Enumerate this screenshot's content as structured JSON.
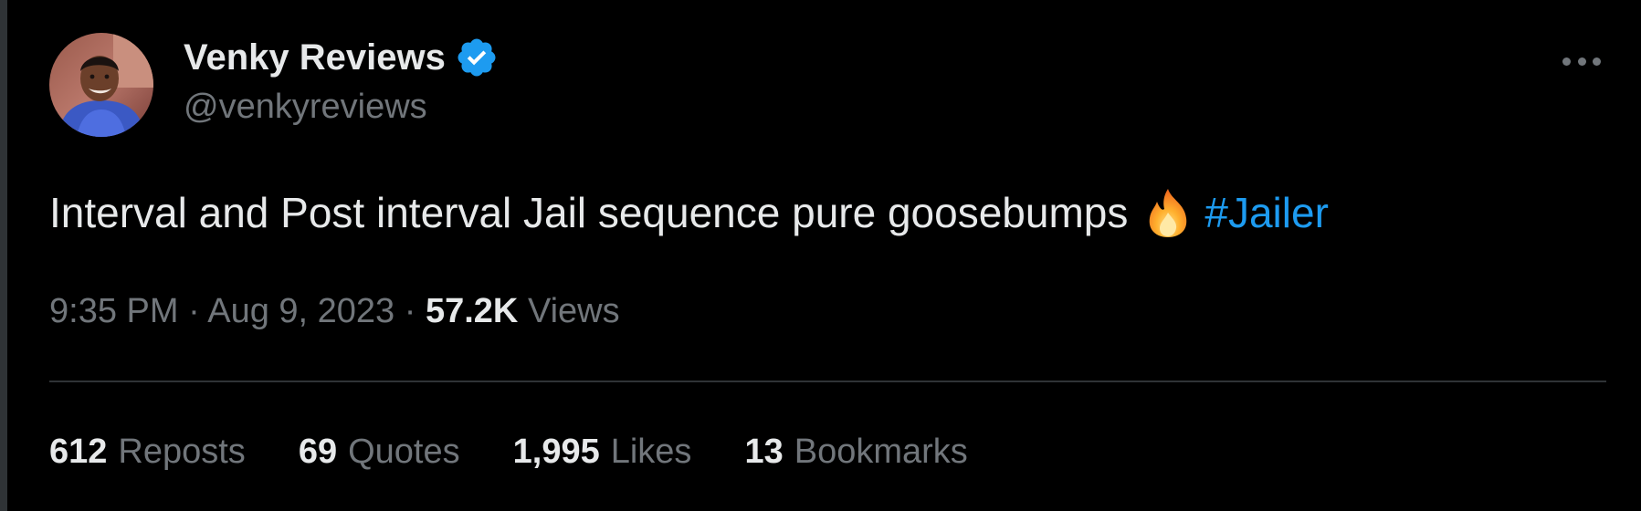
{
  "tweet": {
    "author": {
      "display_name": "Venky Reviews",
      "handle": "@venkyreviews",
      "verified_icon": "verified-badge-icon"
    },
    "text": "Interval and Post interval Jail sequence pure goosebumps",
    "emoji": "fire-emoji",
    "hashtag": "#Jailer",
    "time": "9:35 PM",
    "date": "Aug 9, 2023",
    "separator": "·",
    "views_count": "57.2K",
    "views_label": "Views"
  },
  "stats": [
    {
      "count": "612",
      "label": "Reposts"
    },
    {
      "count": "69",
      "label": "Quotes"
    },
    {
      "count": "1,995",
      "label": "Likes"
    },
    {
      "count": "13",
      "label": "Bookmarks"
    }
  ],
  "colors": {
    "background": "#000000",
    "text_primary": "#e7e9ea",
    "text_secondary": "#71767b",
    "link": "#1d9bf0",
    "divider": "#2f3336"
  }
}
